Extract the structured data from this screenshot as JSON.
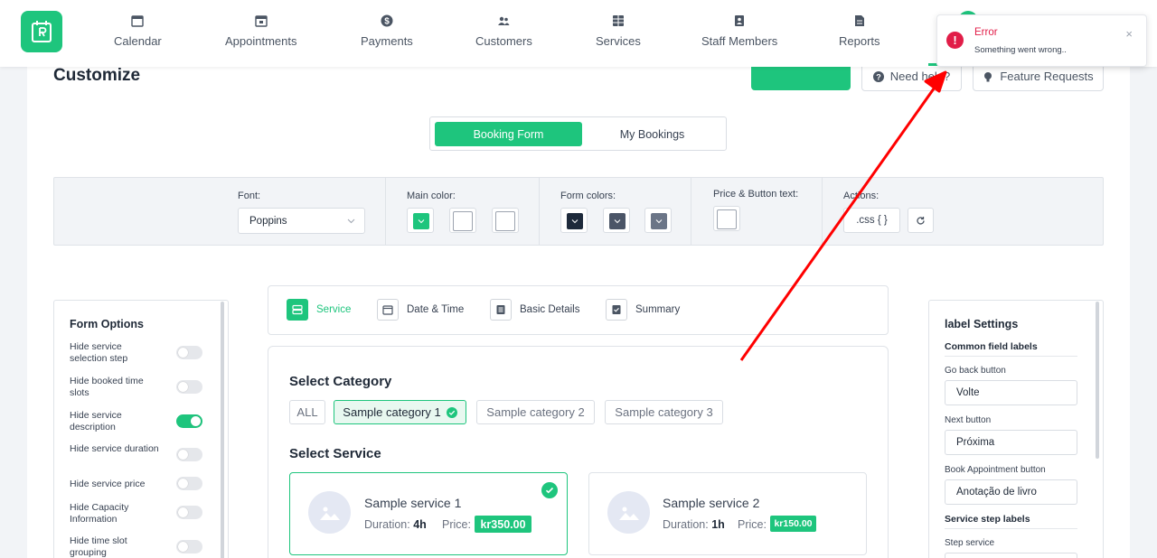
{
  "colors": {
    "accent": "#1ec57d",
    "error": "#e11d48",
    "annotation_arrow": "#ff0000"
  },
  "nav": {
    "items": [
      {
        "label": "Calendar",
        "icon": "calendar-icon"
      },
      {
        "label": "Appointments",
        "icon": "calendar-check-icon"
      },
      {
        "label": "Payments",
        "icon": "dollar-icon"
      },
      {
        "label": "Customers",
        "icon": "users-icon"
      },
      {
        "label": "Services",
        "icon": "grid-icon"
      },
      {
        "label": "Staff Members",
        "icon": "id-badge-icon"
      },
      {
        "label": "Reports",
        "icon": "file-icon"
      }
    ]
  },
  "page": {
    "title": "Customize",
    "need_help": "Need help?",
    "feature_requests": "Feature Requests"
  },
  "tabs": {
    "booking_form": "Booking Form",
    "my_bookings": "My Bookings"
  },
  "stylebar": {
    "font_label": "Font:",
    "font_value": "Poppins",
    "main_color_label": "Main color:",
    "form_colors_label": "Form colors:",
    "price_button_label": "Price & Button text:",
    "actions_label": "Actions:",
    "css_button": ".css { }",
    "main_colors": [
      "#1ec57d",
      "#ffffff",
      "#ffffff"
    ],
    "form_colors": [
      "#1e2a3b",
      "#4b5567",
      "#6b7587"
    ],
    "price_button_color": "#ffffff"
  },
  "form_options": {
    "title": "Form Options",
    "items": [
      {
        "label": "Hide service selection step",
        "on": false
      },
      {
        "label": "Hide booked time slots",
        "on": false
      },
      {
        "label": "Hide service description",
        "on": true
      },
      {
        "label": "Hide service duration",
        "on": false
      },
      {
        "label": "Hide service price",
        "on": false
      },
      {
        "label": "Hide Capacity Information",
        "on": false
      },
      {
        "label": "Hide time slot grouping",
        "on": false
      }
    ]
  },
  "steps": [
    "Service",
    "Date & Time",
    "Basic Details",
    "Summary"
  ],
  "form": {
    "select_category": "Select Category",
    "categories": [
      "ALL",
      "Sample category 1",
      "Sample category 2",
      "Sample category 3"
    ],
    "select_service": "Select Service",
    "services": [
      {
        "name": "Sample service 1",
        "duration_label": "Duration:",
        "duration": "4h",
        "price_label": "Price:",
        "price": "kr350.00"
      },
      {
        "name": "Sample service 2",
        "duration_label": "Duration:",
        "duration": "1h",
        "price_label": "Price:",
        "price": "kr150.00"
      }
    ]
  },
  "label_settings": {
    "title": "label Settings",
    "common_title": "Common field labels",
    "fields": [
      {
        "label": "Go back button",
        "value": "Volte"
      },
      {
        "label": "Next button",
        "value": "Próxima"
      },
      {
        "label": "Book Appointment button",
        "value": "Anotação de livro"
      }
    ],
    "service_step_title": "Service step labels",
    "step_service_label": "Step service"
  },
  "toast": {
    "title": "Error",
    "message": "Something went wrong..",
    "close": "×"
  }
}
